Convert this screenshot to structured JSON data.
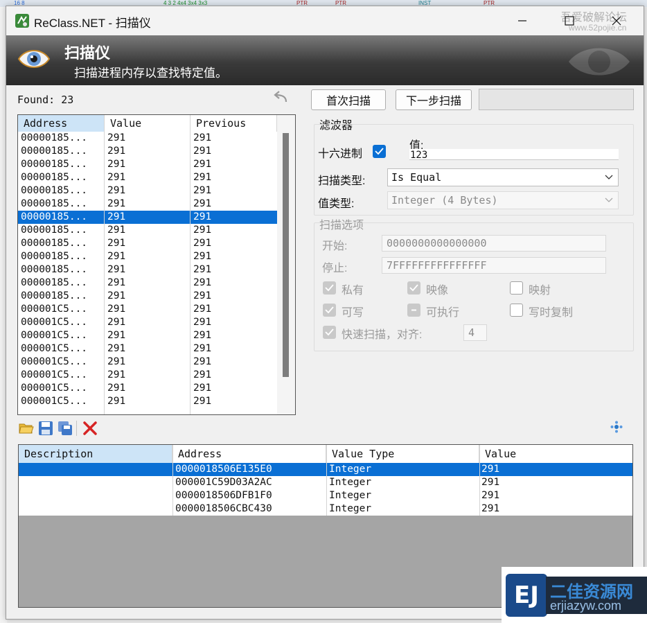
{
  "window": {
    "title": "ReClass.NET - 扫描仪"
  },
  "watermark": {
    "text": "吾爱破解论坛",
    "url": "www.52pojie.cn"
  },
  "banner": {
    "title": "扫描仪",
    "subtitle": "扫描进程内存以查找特定值。"
  },
  "found": {
    "text": "Found: 23"
  },
  "results": {
    "columns": [
      "Address",
      "Value",
      "Previous"
    ],
    "rows": [
      [
        "00000185...",
        "291",
        "291"
      ],
      [
        "00000185...",
        "291",
        "291"
      ],
      [
        "00000185...",
        "291",
        "291"
      ],
      [
        "00000185...",
        "291",
        "291"
      ],
      [
        "00000185...",
        "291",
        "291"
      ],
      [
        "00000185...",
        "291",
        "291"
      ],
      [
        "00000185...",
        "291",
        "291"
      ],
      [
        "00000185...",
        "291",
        "291"
      ],
      [
        "00000185...",
        "291",
        "291"
      ],
      [
        "00000185...",
        "291",
        "291"
      ],
      [
        "00000185...",
        "291",
        "291"
      ],
      [
        "00000185...",
        "291",
        "291"
      ],
      [
        "00000185...",
        "291",
        "291"
      ],
      [
        "000001C5...",
        "291",
        "291"
      ],
      [
        "000001C5...",
        "291",
        "291"
      ],
      [
        "000001C5...",
        "291",
        "291"
      ],
      [
        "000001C5...",
        "291",
        "291"
      ],
      [
        "000001C5...",
        "291",
        "291"
      ],
      [
        "000001C5...",
        "291",
        "291"
      ],
      [
        "000001C5...",
        "291",
        "291"
      ],
      [
        "000001C5...",
        "291",
        "291"
      ]
    ],
    "selected_index": 6
  },
  "buttons": {
    "first_scan": "首次扫描",
    "next_scan": "下一步扫描"
  },
  "filter": {
    "title": "滤波器",
    "hex_label": "十六进制",
    "value_label": "值:",
    "value": "123",
    "scan_type_label": "扫描类型:",
    "scan_type": "Is Equal",
    "value_type_label": "值类型:",
    "value_type": "Integer (4 Bytes)"
  },
  "scan_options": {
    "title": "扫描选项",
    "start_label": "开始:",
    "start_value": "0000000000000000",
    "stop_label": "停止:",
    "stop_value": "7FFFFFFFFFFFFFFF",
    "private": "私有",
    "image": "映像",
    "mapped": "映射",
    "writable": "可写",
    "executable": "可执行",
    "copy_on_write": "写时复制",
    "fast_scan": "快速扫描，对齐:",
    "alignment": "4"
  },
  "address_list": {
    "columns": [
      "Description",
      "Address",
      "Value Type",
      "Value"
    ],
    "rows": [
      [
        "",
        "0000018506E135E0",
        "Integer",
        "291"
      ],
      [
        "",
        "000001C59D03A2AC",
        "Integer",
        "291"
      ],
      [
        "",
        "0000018506DFB1F0",
        "Integer",
        "291"
      ],
      [
        "",
        "0000018506CBC430",
        "Integer",
        "291"
      ]
    ],
    "selected_index": 0
  },
  "badge": {
    "letters": "EJ",
    "title": "二佳资源网",
    "url": "erjiazyw.com"
  },
  "colors": {
    "selection": "#0a6fd4",
    "banner_dark": "#2a2a2a",
    "delete_red": "#d62424"
  }
}
